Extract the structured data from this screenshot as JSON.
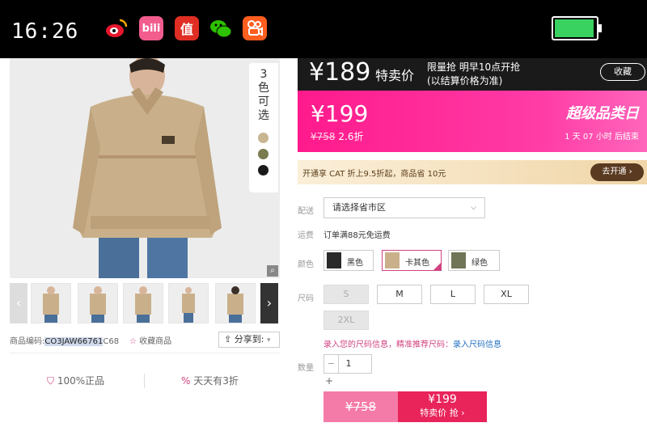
{
  "status_bar": {
    "time": "16:26",
    "app_icons": [
      {
        "name": "weibo-icon",
        "label": "",
        "color": "#e6162d"
      },
      {
        "name": "bilibili-icon",
        "label": "bili",
        "color": "#f25d8e"
      },
      {
        "name": "smzdm-icon",
        "label": "值",
        "color": "#e02e24"
      },
      {
        "name": "wechat-icon",
        "label": "",
        "color": "#2dc100"
      },
      {
        "name": "kuaishou-icon",
        "label": "",
        "color": "#ff5e1f"
      }
    ],
    "battery_level": 0.85
  },
  "gallery": {
    "color_badge": "3色可选",
    "swatch_colors": [
      "#c9b592",
      "#7a7b4e",
      "#1a1a1a"
    ],
    "thumb_count": 5,
    "product_code_label": "商品编码:",
    "product_code_selected": "CO3JAW66761",
    "product_code_rest": "C68",
    "favorite_label": "收藏商品",
    "share_label": "分享到:",
    "guarantee_authentic": "100%正品",
    "guarantee_daily": "天天有3折"
  },
  "price_bar": {
    "price": "¥189",
    "special_label": "特卖价",
    "limited_line1": "限量抢 明早10点开抢",
    "limited_line2": "(以结算价格为准)",
    "favorite_button": "收藏"
  },
  "promo": {
    "price": "¥199",
    "original_price": "¥758",
    "discount": "2.6折",
    "banner": "超级品类日",
    "countdown_days": "1",
    "countdown_day_label": "天",
    "countdown_hours": "07",
    "countdown_hour_label": "小时",
    "countdown_end": "后结束"
  },
  "membership": {
    "text": "开通享 CAT 折上9.5折起，商品省 10元",
    "button": "去开通 ›"
  },
  "options": {
    "delivery_label": "配送",
    "delivery_placeholder": "请选择省市区",
    "shipping_label": "运费",
    "shipping_text": "订单满88元免运费",
    "color_label": "颜色",
    "colors": [
      {
        "name": "黑色",
        "selected": false
      },
      {
        "name": "卡其色",
        "selected": true
      },
      {
        "name": "绿色",
        "selected": false
      }
    ],
    "size_label": "尺码",
    "sizes": [
      {
        "name": "S",
        "available": false
      },
      {
        "name": "M",
        "available": true
      },
      {
        "name": "L",
        "available": true
      },
      {
        "name": "XL",
        "available": true
      },
      {
        "name": "2XL",
        "available": false
      }
    ],
    "size_hint_pink": "录入您的尺码信息，精准推荐尺码：",
    "size_hint_blue": "录入尺码信息",
    "quantity_label": "数量",
    "quantity_value": "1",
    "minus": "−",
    "plus": "+"
  },
  "buy": {
    "original": "¥758",
    "price": "¥199",
    "action": "特卖价 抢 ›"
  }
}
